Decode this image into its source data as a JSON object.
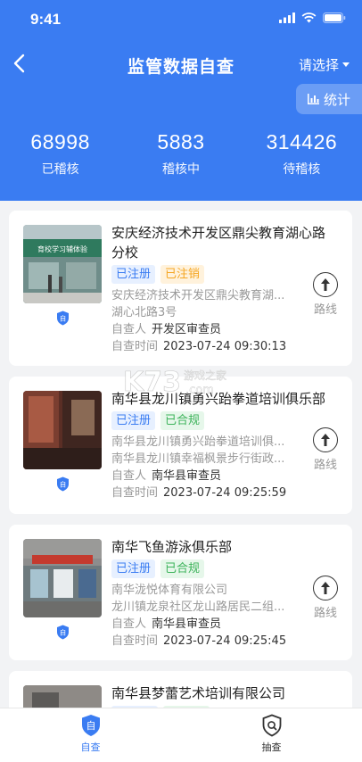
{
  "status_bar": {
    "time": "9:41"
  },
  "nav": {
    "title": "监管数据自查",
    "select_label": "请选择",
    "stats_label": "统计"
  },
  "summary": [
    {
      "value": "68998",
      "label": "已稽核"
    },
    {
      "value": "5883",
      "label": "稽核中"
    },
    {
      "value": "314426",
      "label": "待稽核"
    }
  ],
  "cards": [
    {
      "title_line1": "安庆经济技术开发区鼎尖教育湖心路",
      "title_line2": "分校",
      "tags": [
        "已注册",
        "已注销"
      ],
      "addr1": "安庆经济技术开发区鼎尖教育湖...",
      "addr2": "湖心北路3号",
      "inspector_label": "自查人",
      "inspector": "开发区审查员",
      "time_label": "自查时间",
      "time": "2023-07-24 09:30:13",
      "badge": "自",
      "route_label": "路线"
    },
    {
      "title_line1": "南华县龙川镇勇兴跆拳道培训俱乐部",
      "tags": [
        "已注册",
        "已合规"
      ],
      "addr1": "南华县龙川镇勇兴跆拳道培训俱...",
      "addr2": "南华县龙川镇幸福枫景步行街政...",
      "inspector_label": "自查人",
      "inspector": "南华县审查员",
      "time_label": "自查时间",
      "time": "2023-07-24 09:25:59",
      "badge": "自",
      "route_label": "路线"
    },
    {
      "title_line1": "南华飞鱼游泳俱乐部",
      "tags": [
        "已注册",
        "已合规"
      ],
      "addr1": "南华泷悦体育有限公司",
      "addr2": "龙川镇龙泉社区龙山路居民二组...",
      "inspector_label": "自查人",
      "inspector": "南华县审查员",
      "time_label": "自查时间",
      "time": "2023-07-24 09:25:45",
      "badge": "自",
      "route_label": "路线"
    },
    {
      "title_line1": "南华县梦蕾艺术培训有限公司"
    }
  ],
  "photo1_sign": "育校学习辅体验",
  "watermark": {
    "main": "K73",
    "sub": "游戏之家",
    "domain": ".com"
  },
  "tabbar": [
    {
      "label": "自查",
      "icon_glyph": "自"
    },
    {
      "label": "抽查"
    }
  ],
  "colors": {
    "primary": "#3a7cf2",
    "tag_orange": "#f5a623",
    "tag_green": "#3cb35a"
  }
}
